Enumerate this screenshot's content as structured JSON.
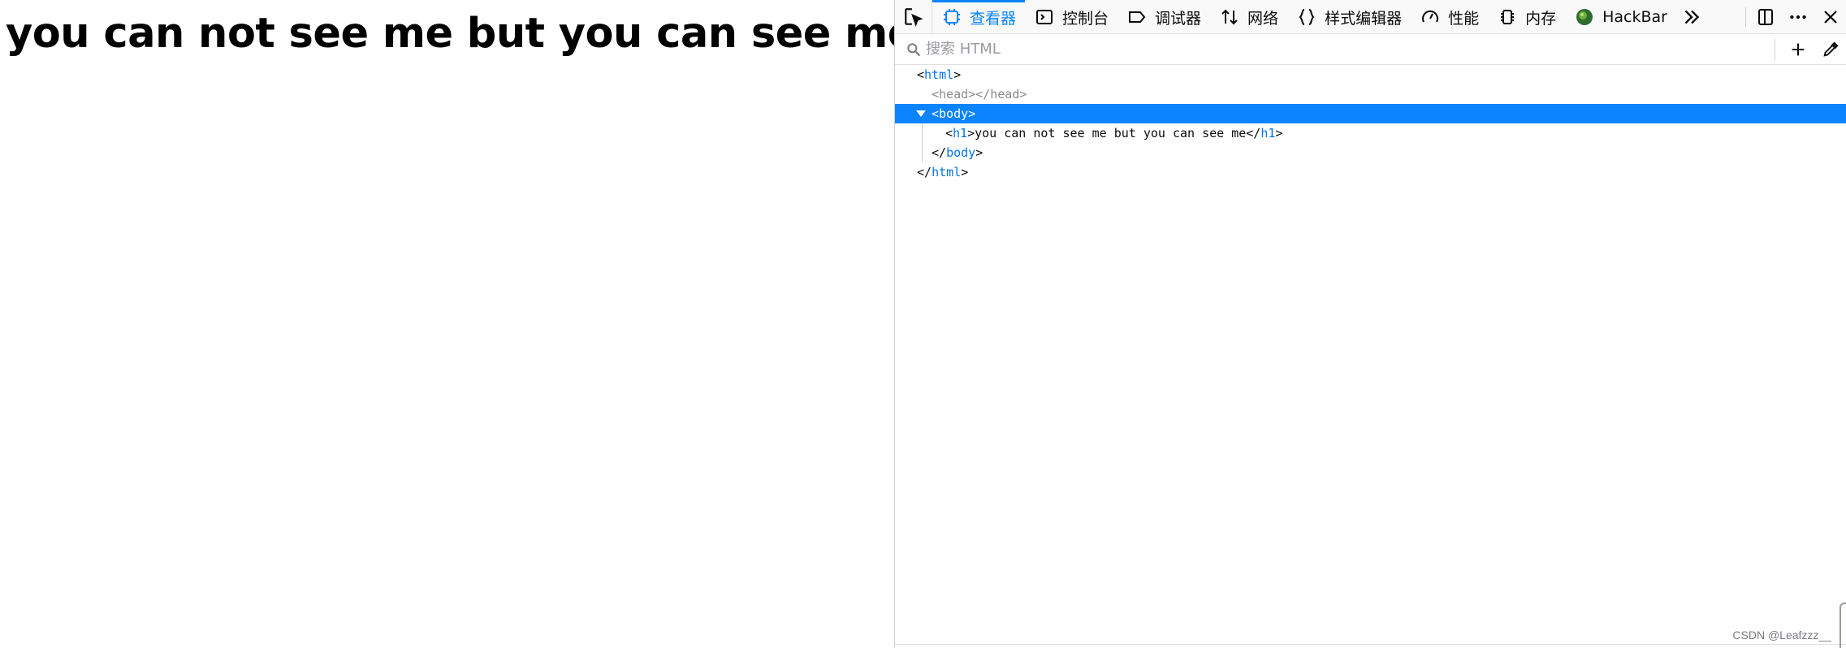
{
  "page": {
    "heading": "you can not see me but you can see me"
  },
  "devtools": {
    "tabs": [
      {
        "label": "查看器",
        "icon": "inspector-icon",
        "active": true
      },
      {
        "label": "控制台",
        "icon": "console-icon",
        "active": false
      },
      {
        "label": "调试器",
        "icon": "debugger-icon",
        "active": false
      },
      {
        "label": "网络",
        "icon": "network-icon",
        "active": false
      },
      {
        "label": "样式编辑器",
        "icon": "style-editor-icon",
        "active": false
      },
      {
        "label": "性能",
        "icon": "performance-icon",
        "active": false
      },
      {
        "label": "内存",
        "icon": "memory-icon",
        "active": false
      },
      {
        "label": "HackBar",
        "icon": "hackbar-icon",
        "active": false
      }
    ],
    "search_placeholder": "搜索 HTML",
    "tree": {
      "html_open_tag": "html",
      "head_tag": "head",
      "body_tag": "body",
      "h1_tag": "h1",
      "h1_text": "you can not see me but you can see me"
    },
    "accent_color": "#0a84ff",
    "tag_color": "#0074e8"
  },
  "watermark": "CSDN @Leafzzz__"
}
